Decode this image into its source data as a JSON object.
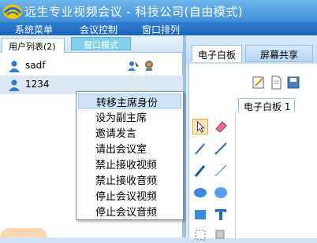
{
  "window": {
    "title": "远生专业视频会议 - 科技公司(自由模式)"
  },
  "menubar": {
    "items": [
      "系统菜单",
      "会议控制",
      "窗口排列"
    ]
  },
  "left_panel": {
    "tabs": [
      "用户列表(2)",
      "窗口模式"
    ],
    "users": [
      {
        "name": "sadf"
      },
      {
        "name": "1234"
      }
    ]
  },
  "context_menu": {
    "items": [
      "转移主席身份",
      "设为副主席",
      "邀请发言",
      "请出会议室",
      "禁止接收视频",
      "禁止接收音频",
      "停止会议视频",
      "停止会议音频"
    ],
    "selected_index": 0
  },
  "right_panel": {
    "tabs": [
      "电子白板",
      "屏幕共享"
    ],
    "doc_tab": "电子白板 1"
  },
  "colors": {
    "menubar": "#1c64b8",
    "titlebar": "#3f8fd8",
    "selection": "#cfe3f8"
  }
}
